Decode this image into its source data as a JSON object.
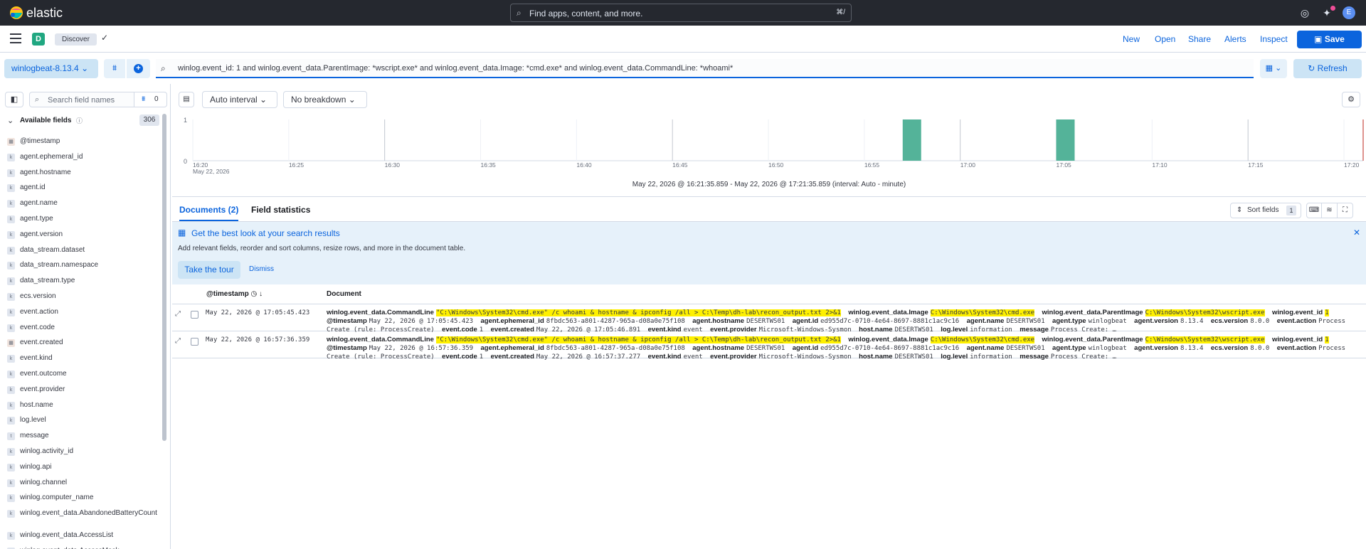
{
  "header": {
    "brand": "elastic",
    "search_placeholder": "Find apps, content, and more.",
    "search_shortcut": "⌘/",
    "avatar_initial": "E"
  },
  "appbar": {
    "space_initial": "D",
    "breadcrumb": "Discover",
    "links": {
      "new": "New",
      "open": "Open",
      "share": "Share",
      "alerts": "Alerts",
      "inspect": "Inspect"
    },
    "save_label": "Save"
  },
  "query": {
    "data_view": "winlogbeat-8.13.4",
    "text": "winlog.event_id: 1 and winlog.event_data.ParentImage: *wscript.exe* and winlog.event_data.Image: *cmd.exe* and winlog.event_data.CommandLine: *whoami*",
    "refresh_label": "Refresh"
  },
  "sidebar": {
    "search_placeholder": "Search field names",
    "filter_count": "0",
    "available_label": "Available fields",
    "available_count": "306",
    "fields": [
      {
        "name": "@timestamp",
        "type": "date"
      },
      {
        "name": "agent.ephemeral_id",
        "type": "k"
      },
      {
        "name": "agent.hostname",
        "type": "k"
      },
      {
        "name": "agent.id",
        "type": "k"
      },
      {
        "name": "agent.name",
        "type": "k"
      },
      {
        "name": "agent.type",
        "type": "k"
      },
      {
        "name": "agent.version",
        "type": "k"
      },
      {
        "name": "data_stream.dataset",
        "type": "k"
      },
      {
        "name": "data_stream.namespace",
        "type": "k"
      },
      {
        "name": "data_stream.type",
        "type": "k"
      },
      {
        "name": "ecs.version",
        "type": "k"
      },
      {
        "name": "event.action",
        "type": "k"
      },
      {
        "name": "event.code",
        "type": "k"
      },
      {
        "name": "event.created",
        "type": "date"
      },
      {
        "name": "event.kind",
        "type": "k"
      },
      {
        "name": "event.outcome",
        "type": "k"
      },
      {
        "name": "event.provider",
        "type": "k"
      },
      {
        "name": "host.name",
        "type": "k"
      },
      {
        "name": "log.level",
        "type": "k"
      },
      {
        "name": "message",
        "type": "t"
      },
      {
        "name": "winlog.activity_id",
        "type": "k"
      },
      {
        "name": "winlog.api",
        "type": "k"
      },
      {
        "name": "winlog.channel",
        "type": "k"
      },
      {
        "name": "winlog.computer_name",
        "type": "k"
      },
      {
        "name": "winlog.event_data.AbandonedBatteryCount",
        "type": "k"
      },
      {
        "name": "winlog.event_data.AccessList",
        "type": "k"
      },
      {
        "name": "winlog.event_data.AccessMask",
        "type": "k"
      }
    ]
  },
  "chart_toolbar": {
    "interval": "Auto interval",
    "breakdown": "No breakdown"
  },
  "histogram": {
    "y_ticks": [
      "1",
      "0"
    ],
    "x_ticks": [
      "16:20",
      "16:25",
      "16:30",
      "16:35",
      "16:40",
      "16:45",
      "16:50",
      "16:55",
      "17:00",
      "17:05",
      "17:10",
      "17:15",
      "17:20"
    ],
    "x_sub": "May 22, 2026",
    "bar_color": "#54b399",
    "bars_minutes_after_1620": [
      37,
      45
    ],
    "bar_value": 1,
    "range_minutes": 61,
    "time_range_text": "May 22, 2026 @ 16:21:35.859 - May 22, 2026 @ 17:21:35.859 (interval: Auto - minute)"
  },
  "tabs": {
    "documents": "Documents (2)",
    "field_stats": "Field statistics",
    "sort_label": "Sort fields",
    "sort_count": "1"
  },
  "callout": {
    "title": "Get the best look at your search results",
    "body": "Add relevant fields, reorder and sort columns, resize rows, and more in the document table.",
    "tour": "Take the tour",
    "dismiss": "Dismiss"
  },
  "table": {
    "col_timestamp": "@timestamp",
    "col_document": "Document",
    "rows": [
      {
        "timestamp": "May 22, 2026 @ 17:05:45.423",
        "pairs": [
          {
            "k": "winlog.event_data.CommandLine",
            "v": "\"C:\\Windows\\System32\\cmd.exe\" /c whoami & hostname & ipconfig /all > C:\\Temp\\dh-lab\\recon_output.txt 2>&1",
            "hl": true
          },
          {
            "k": "winlog.event_data.Image",
            "v": "C:\\Windows\\System32\\cmd.exe",
            "hl": true
          },
          {
            "k": "winlog.event_data.ParentImage",
            "v": "C:\\Windows\\System32\\wscript.exe",
            "hl": true
          },
          {
            "k": "winlog.event_id",
            "v": "1",
            "hl": true
          },
          {
            "k": "@timestamp",
            "v": "May 22, 2026 @ 17:05:45.423",
            "hl": false
          },
          {
            "k": "agent.ephemeral_id",
            "v": "8fbdc563-a801-4287-965a-d08a0e75f108",
            "hl": false
          },
          {
            "k": "agent.hostname",
            "v": "DESERTWS01",
            "hl": false
          },
          {
            "k": "agent.id",
            "v": "ed955d7c-0710-4e64-8697-8881c1ac9c16",
            "hl": false
          },
          {
            "k": "agent.name",
            "v": "DESERTWS01",
            "hl": false
          },
          {
            "k": "agent.type",
            "v": "winlogbeat",
            "hl": false
          },
          {
            "k": "agent.version",
            "v": "8.13.4",
            "hl": false
          },
          {
            "k": "ecs.version",
            "v": "8.0.0",
            "hl": false
          },
          {
            "k": "event.action",
            "v": "Process Create (rule: ProcessCreate)",
            "hl": false
          },
          {
            "k": "event.code",
            "v": "1",
            "hl": false
          },
          {
            "k": "event.created",
            "v": "May 22, 2026 @ 17:05:46.891",
            "hl": false
          },
          {
            "k": "event.kind",
            "v": "event",
            "hl": false
          },
          {
            "k": "event.provider",
            "v": "Microsoft-Windows-Sysmon",
            "hl": false
          },
          {
            "k": "host.name",
            "v": "DESERTWS01",
            "hl": false
          },
          {
            "k": "log.level",
            "v": "information",
            "hl": false
          },
          {
            "k": "message",
            "v": "Process Create: …",
            "hl": false
          }
        ]
      },
      {
        "timestamp": "May 22, 2026 @ 16:57:36.359",
        "pairs": [
          {
            "k": "winlog.event_data.CommandLine",
            "v": "\"C:\\Windows\\System32\\cmd.exe\" /c whoami & hostname & ipconfig /all > C:\\Temp\\dh-lab\\recon_output.txt 2>&1",
            "hl": true
          },
          {
            "k": "winlog.event_data.Image",
            "v": "C:\\Windows\\System32\\cmd.exe",
            "hl": true
          },
          {
            "k": "winlog.event_data.ParentImage",
            "v": "C:\\Windows\\System32\\wscript.exe",
            "hl": true
          },
          {
            "k": "winlog.event_id",
            "v": "1",
            "hl": true
          },
          {
            "k": "@timestamp",
            "v": "May 22, 2026 @ 16:57:36.359",
            "hl": false
          },
          {
            "k": "agent.ephemeral_id",
            "v": "8fbdc563-a801-4287-965a-d08a0e75f108",
            "hl": false
          },
          {
            "k": "agent.hostname",
            "v": "DESERTWS01",
            "hl": false
          },
          {
            "k": "agent.id",
            "v": "ed955d7c-0710-4e64-8697-8881c1ac9c16",
            "hl": false
          },
          {
            "k": "agent.name",
            "v": "DESERTWS01",
            "hl": false
          },
          {
            "k": "agent.type",
            "v": "winlogbeat",
            "hl": false
          },
          {
            "k": "agent.version",
            "v": "8.13.4",
            "hl": false
          },
          {
            "k": "ecs.version",
            "v": "8.0.0",
            "hl": false
          },
          {
            "k": "event.action",
            "v": "Process Create (rule: ProcessCreate)",
            "hl": false
          },
          {
            "k": "event.code",
            "v": "1",
            "hl": false
          },
          {
            "k": "event.created",
            "v": "May 22, 2026 @ 16:57:37.277",
            "hl": false
          },
          {
            "k": "event.kind",
            "v": "event",
            "hl": false
          },
          {
            "k": "event.provider",
            "v": "Microsoft-Windows-Sysmon",
            "hl": false
          },
          {
            "k": "host.name",
            "v": "DESERTWS01",
            "hl": false
          },
          {
            "k": "log.level",
            "v": "information",
            "hl": false
          },
          {
            "k": "message",
            "v": "Process Create: …",
            "hl": false
          }
        ]
      }
    ]
  }
}
